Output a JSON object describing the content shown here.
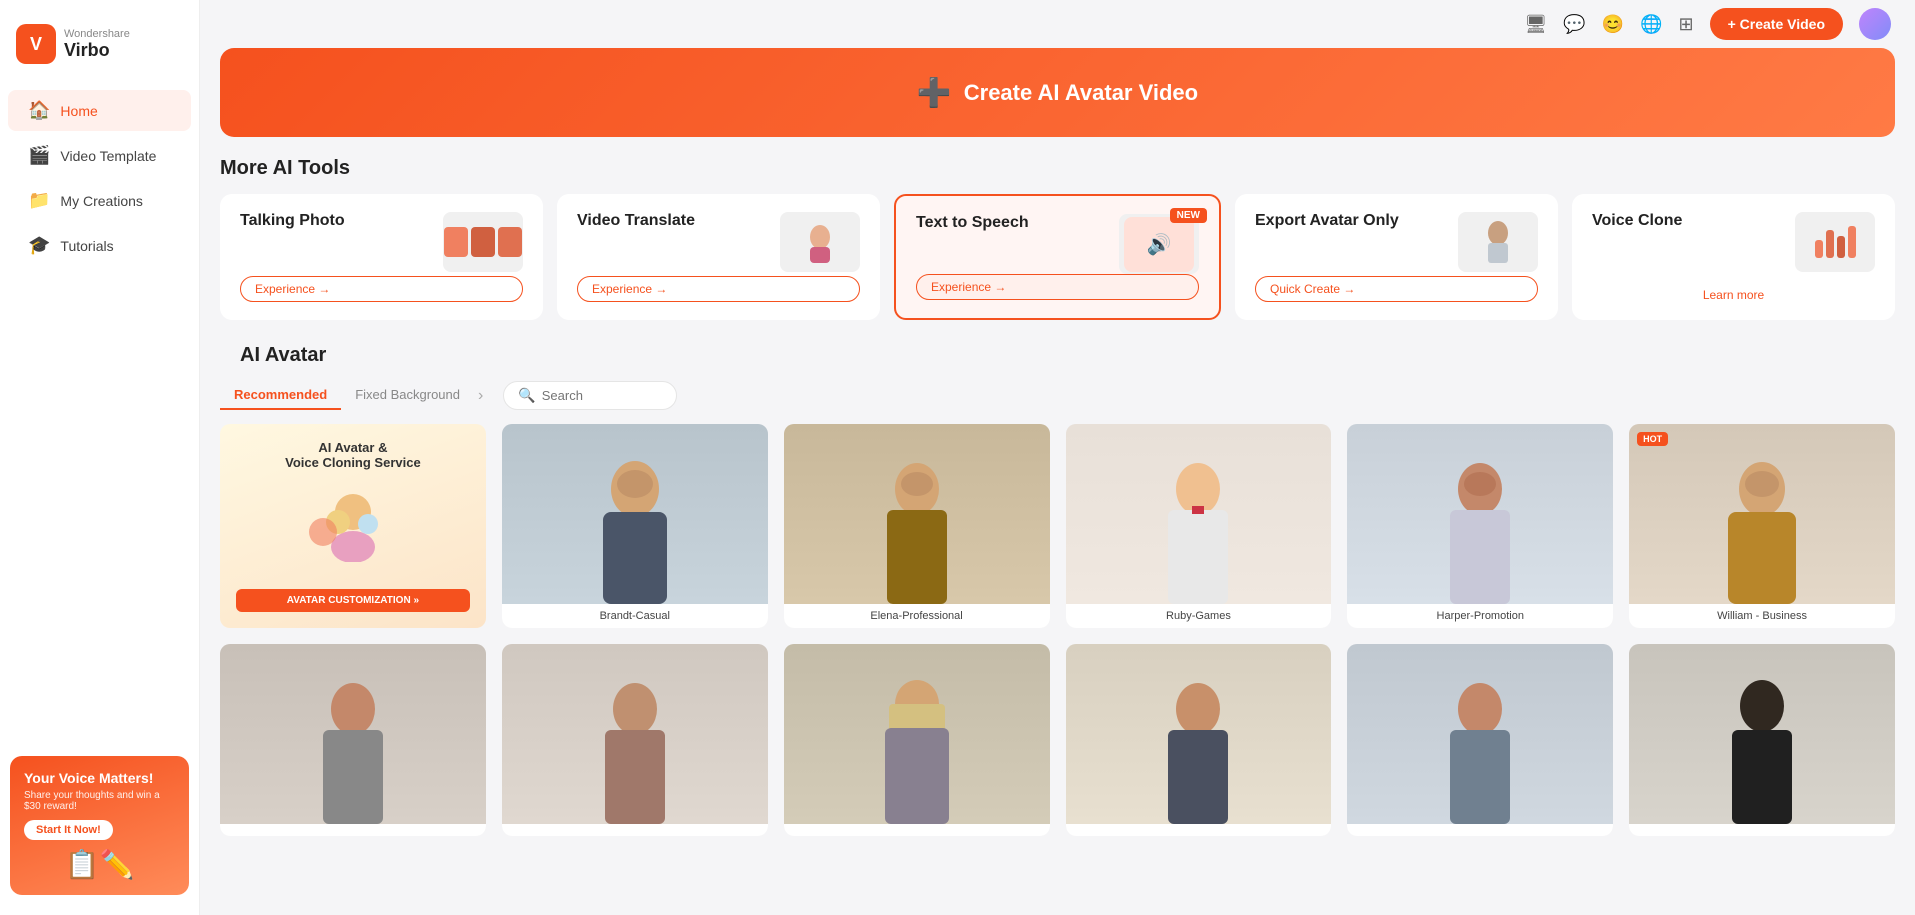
{
  "app": {
    "company": "Wondershare",
    "product": "Virbo"
  },
  "topbar": {
    "create_video_label": "+ Create Video"
  },
  "sidebar": {
    "items": [
      {
        "id": "home",
        "label": "Home",
        "icon": "🏠",
        "active": true
      },
      {
        "id": "video-template",
        "label": "Video Template",
        "icon": "🎬",
        "active": false
      },
      {
        "id": "my-creations",
        "label": "My Creations",
        "icon": "🎓",
        "active": false
      },
      {
        "id": "tutorials",
        "label": "Tutorials",
        "icon": "🎓",
        "active": false
      }
    ],
    "promo": {
      "title": "Your Voice Matters!",
      "description": "Share your thoughts and win a $30 reward!",
      "button_label": "Start It Now!"
    }
  },
  "hero": {
    "label": "Create AI Avatar Video"
  },
  "ai_tools": {
    "section_title": "More AI Tools",
    "cards": [
      {
        "id": "talking-photo",
        "title": "Talking Photo",
        "button_label": "Experience →",
        "highlighted": false,
        "new": false
      },
      {
        "id": "video-translate",
        "title": "Video Translate",
        "button_label": "Experience →",
        "highlighted": false,
        "new": false
      },
      {
        "id": "text-to-speech",
        "title": "Text to Speech",
        "button_label": "Experience →",
        "highlighted": true,
        "new": true,
        "new_label": "NEW"
      },
      {
        "id": "export-avatar",
        "title": "Export Avatar Only",
        "button_label": "Quick Create →",
        "highlighted": false,
        "new": false
      },
      {
        "id": "voice-clone",
        "title": "Voice Clone",
        "button_label": "Learn more",
        "highlighted": false,
        "new": false
      }
    ]
  },
  "avatar_section": {
    "title": "AI Avatar",
    "tabs": [
      {
        "label": "Recommended",
        "active": true
      },
      {
        "label": "Fixed Background",
        "active": false
      }
    ],
    "search_placeholder": "Search",
    "avatars": [
      {
        "id": "promo",
        "type": "promo",
        "title": "AI Avatar &\nVoice Cloning Service",
        "btn": "AVATAR CUSTOMIZATION »"
      },
      {
        "id": "brandt",
        "name": "Brandt-Casual",
        "hot": false,
        "bg": "#b8c4cc",
        "skin": "#d4a574"
      },
      {
        "id": "elena",
        "name": "Elena-Professional",
        "hot": false,
        "bg": "#c8b89a",
        "skin": "#d4a574"
      },
      {
        "id": "ruby",
        "name": "Ruby-Games",
        "hot": false,
        "bg": "#e8e0d8",
        "skin": "#f0c090"
      },
      {
        "id": "harper",
        "name": "Harper-Promotion",
        "hot": false,
        "bg": "#c8d0d8",
        "skin": "#c4886a"
      },
      {
        "id": "william",
        "name": "William - Business",
        "hot": true,
        "bg": "#d4c8b8",
        "skin": "#d4a574"
      }
    ],
    "avatars_row2": [
      {
        "id": "av7",
        "name": "",
        "bg": "#c8c0b8",
        "skin": "#c4886a"
      },
      {
        "id": "av8",
        "name": "",
        "bg": "#d0c8c0",
        "skin": "#c09070"
      },
      {
        "id": "av9",
        "name": "",
        "bg": "#c4bca8",
        "skin": "#d4a574"
      },
      {
        "id": "av10",
        "name": "",
        "bg": "#d8d0c0",
        "skin": "#c8906a"
      },
      {
        "id": "av11",
        "name": "",
        "bg": "#c0c8d0",
        "skin": "#c4886a"
      },
      {
        "id": "av12",
        "name": "",
        "bg": "#c8c4bc",
        "skin": "#302820"
      }
    ]
  }
}
